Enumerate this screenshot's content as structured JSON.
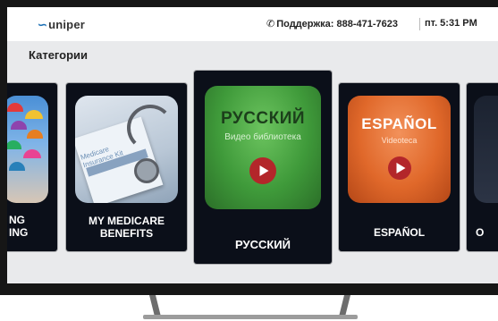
{
  "app": {
    "logo": "uniper"
  },
  "header": {
    "support": "Поддержка: 888-471-7623",
    "datetime": "пт. 5:31 PM"
  },
  "section": {
    "title": "Категории"
  },
  "cards": [
    {
      "label_line1": "NG",
      "label_line2": "ING"
    },
    {
      "label_line1": "MY MEDICARE",
      "label_line2": "BENEFITS",
      "thumb_text_line1": "Medicare",
      "thumb_text_line2": "Insurance Kit"
    },
    {
      "label": "РУССКИЙ",
      "thumb_title": "РУССКИЙ",
      "thumb_subtitle": "Видео библиотека"
    },
    {
      "label": "ESPAÑOL",
      "thumb_title": "ESPAÑOL",
      "thumb_subtitle": "Videoteca"
    },
    {
      "label": "O"
    }
  ],
  "colors": {
    "screen_bg": "#e9eaec",
    "card_bg": "#0b0f19",
    "russian_green": "#3f9a3a",
    "spanish_orange": "#e0682a",
    "play_red": "#b3262a",
    "logo_blue": "#1a6fb5"
  },
  "icons": {
    "phone": "phone-icon",
    "play": "play-icon",
    "logo": "uniper-logo-mark"
  }
}
